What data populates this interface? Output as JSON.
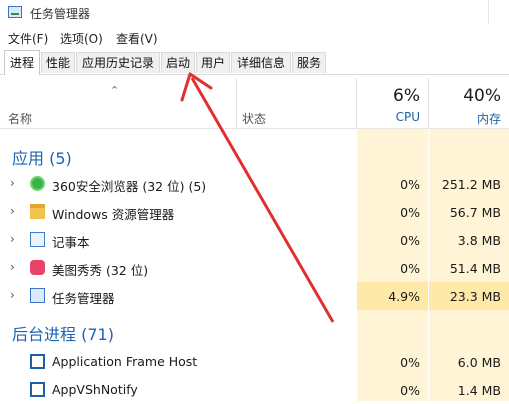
{
  "window": {
    "title": "任务管理器"
  },
  "menu": {
    "file": "文件(F)",
    "options": "选项(O)",
    "view": "查看(V)"
  },
  "tabs": [
    "进程",
    "性能",
    "应用历史记录",
    "启动",
    "用户",
    "详细信息",
    "服务"
  ],
  "active_tab": "进程",
  "columns": {
    "name": "名称",
    "status": "状态",
    "cpu": {
      "pct": "6%",
      "label": "CPU"
    },
    "mem": {
      "pct": "40%",
      "label": "内存"
    }
  },
  "sections": {
    "apps": "应用 (5)",
    "background": "后台进程 (71)"
  },
  "apps": [
    {
      "name": "360安全浏览器 (32 位) (5)",
      "cpu": "0%",
      "mem": "251.2 MB",
      "icon": "360-browser-icon"
    },
    {
      "name": "Windows 资源管理器",
      "cpu": "0%",
      "mem": "56.7 MB",
      "icon": "folder-icon"
    },
    {
      "name": "记事本",
      "cpu": "0%",
      "mem": "3.8 MB",
      "icon": "notepad-icon"
    },
    {
      "name": "美图秀秀 (32 位)",
      "cpu": "0%",
      "mem": "51.4 MB",
      "icon": "meitu-icon"
    },
    {
      "name": "任务管理器",
      "cpu": "4.9%",
      "mem": "23.3 MB",
      "icon": "taskmgr-icon"
    }
  ],
  "background": [
    {
      "name": "Application Frame Host",
      "cpu": "0%",
      "mem": "6.0 MB",
      "icon": "frame-icon"
    },
    {
      "name": "AppVShNotify",
      "cpu": "0%",
      "mem": "1.4 MB",
      "icon": "frame-icon"
    }
  ],
  "annotation_color": "#e0312f",
  "highlight_color": "#ffe9a8",
  "column_tint": "#fff5d6"
}
